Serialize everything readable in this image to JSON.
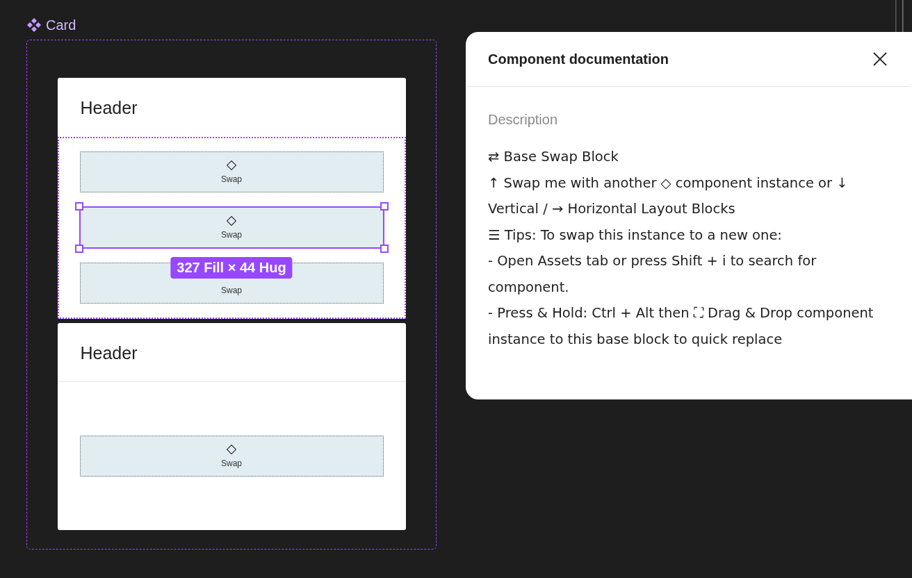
{
  "component_label": "Card",
  "cards": [
    {
      "header": "Header",
      "body_selected": true,
      "slots": [
        {
          "label": "Swap",
          "selected": false
        },
        {
          "label": "Swap",
          "selected": true
        },
        {
          "label": "Swap",
          "selected": false
        }
      ]
    },
    {
      "header": "Header",
      "body_selected": false,
      "slots": [
        {
          "label": "Swap",
          "selected": false
        }
      ]
    }
  ],
  "size_badge": "327 Fill × 44 Hug",
  "panel": {
    "title": "Component documentation",
    "section_label": "Description",
    "paragraphs": [
      "⇄ Base Swap Block",
      "↑ Swap me with another ◇ component instance or ↓ Vertical / → Horizontal Layout Blocks",
      "☰ Tips: To swap this instance to a new one:",
      "- Open Assets tab or press Shift + i to search for component.",
      "- Press & Hold: Ctrl + Alt then ⛶ Drag & Drop component instance to this base block to quick replace"
    ]
  }
}
